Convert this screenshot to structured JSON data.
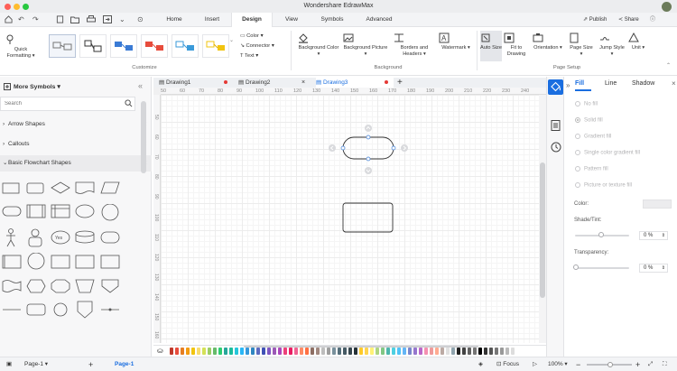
{
  "app": {
    "title": "Wondershare EdrawMax"
  },
  "menu": {
    "tabs": [
      {
        "label": "Home"
      },
      {
        "label": "Insert"
      },
      {
        "label": "Design"
      },
      {
        "label": "View"
      },
      {
        "label": "Symbols"
      },
      {
        "label": "Advanced"
      }
    ],
    "active_tab": "Design",
    "publish_label": "Publish",
    "share_label": "Share"
  },
  "ribbon": {
    "quick_formatting": "Quick Formatting",
    "color_label": "Color",
    "connector_label": "Connector",
    "text_label": "Text",
    "customize_group": "Customize",
    "background_color": "Background Color",
    "background_picture": "Background Picture",
    "borders_headers": "Borders and Headers",
    "watermark": "Watermark",
    "background_group": "Background",
    "auto_size": "Auto Size",
    "fit_to_drawing": "Fit to Drawing",
    "orientation": "Orientation",
    "page_size": "Page Size",
    "jump_style": "Jump Style",
    "unit": "Unit",
    "page_setup_group": "Page Setup"
  },
  "left_panel": {
    "header": "More Symbols",
    "search_placeholder": "Search",
    "libraries": [
      {
        "label": "Arrow Shapes"
      },
      {
        "label": "Callouts"
      },
      {
        "label": "Basic Flowchart Shapes"
      }
    ]
  },
  "doc_tabs": [
    {
      "label": "Drawing1"
    },
    {
      "label": "Drawing2"
    },
    {
      "label": "Drawing3"
    }
  ],
  "ruler": {
    "h_ticks": [
      "50",
      "60",
      "70",
      "80",
      "90",
      "100",
      "110",
      "120",
      "130",
      "140",
      "150",
      "160",
      "170",
      "180",
      "190",
      "200",
      "210",
      "220",
      "230",
      "240"
    ],
    "v_ticks": [
      "50",
      "60",
      "70",
      "80",
      "90",
      "100",
      "110",
      "120",
      "130",
      "140",
      "150",
      "160"
    ]
  },
  "right_panel": {
    "tabs": [
      {
        "label": "Fill"
      },
      {
        "label": "Line"
      },
      {
        "label": "Shadow"
      }
    ],
    "fill_options": [
      {
        "label": "No fill"
      },
      {
        "label": "Solid fill"
      },
      {
        "label": "Gradient fill"
      },
      {
        "label": "Single color gradient fill"
      },
      {
        "label": "Pattern fill"
      },
      {
        "label": "Picture or texture fill"
      }
    ],
    "color_label": "Color:",
    "shade_label": "Shade/Tint:",
    "shade_value": "0 %",
    "transparency_label": "Transparency:",
    "transparency_value": "0 %"
  },
  "status": {
    "page_select": "Page-1",
    "page_tab": "Page-1",
    "focus_label": "Focus",
    "zoom": "100%"
  },
  "colors": {
    "accent": "#1a6ee0",
    "palette": [
      "#c0392b",
      "#e74c3c",
      "#e67e22",
      "#f39c12",
      "#f1c40f",
      "#f7dc6f",
      "#d4e157",
      "#9ccc65",
      "#66bb6a",
      "#2ecc71",
      "#26a69a",
      "#1abc9c",
      "#26c6da",
      "#29b6f6",
      "#3498db",
      "#2e86c1",
      "#5c6bc0",
      "#3f51b5",
      "#7e57c2",
      "#9b59b6",
      "#ab47bc",
      "#ec407a",
      "#e91e63",
      "#f06292",
      "#ff8a65",
      "#ff7043",
      "#8d6e63",
      "#a1887f",
      "#bdbdbd",
      "#9e9e9e",
      "#78909c",
      "#546e7a",
      "#455a64",
      "#37474f",
      "#263238",
      "#ffca28",
      "#ffd54f",
      "#fff176",
      "#aed581",
      "#81c784",
      "#4db6ac",
      "#4dd0e1",
      "#4fc3f7",
      "#64b5f6",
      "#7986cb",
      "#9575cd",
      "#ba68c8",
      "#f48fb1",
      "#ef9a9a",
      "#ffab91",
      "#bcaaa4",
      "#e0e0e0",
      "#90a4ae",
      "#212121",
      "#424242",
      "#616161",
      "#757575",
      "#000000",
      "#333333",
      "#555555",
      "#777777",
      "#999999",
      "#bbbbbb",
      "#dddddd"
    ]
  }
}
